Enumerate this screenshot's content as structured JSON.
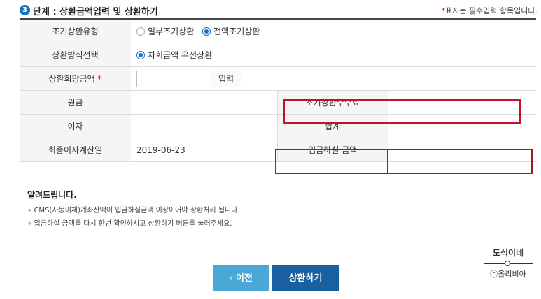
{
  "header": {
    "step_number": "3",
    "title": "단계 : 상환금액입력 및 상환하기",
    "required_star": "*",
    "required_note": "표시는 필수입력 항목입니다."
  },
  "form": {
    "type_label": "조기상환유형",
    "type_options": [
      {
        "label": "일부조기상환",
        "selected": false
      },
      {
        "label": "전액조기상환",
        "selected": true
      }
    ],
    "method_label": "상환방식선택",
    "method_option": {
      "label": "차회금액 우선상환",
      "selected": true
    },
    "amount_label": "상환희망금액",
    "amount_star": "*",
    "amount_value": "",
    "amount_button": "입력",
    "principal_label": "원금",
    "principal_value": "",
    "fee_label": "조기상환수수료",
    "fee_value": "",
    "interest_label": "이자",
    "interest_value": "",
    "total_label": "합계",
    "total_value": "",
    "last_interest_label": "최종이자계산일",
    "last_interest_date": "2019-06-23",
    "deposit_label": "입금하실 금액",
    "deposit_value": ""
  },
  "notice": {
    "title": "알려드립니다.",
    "lines": [
      "CMS(자동이체)계좌잔액이 입금하실금액 이상이어야 상환처리 됩니다.",
      "입금하실 금액을 다시 한번 확인하시고 상환하기 버튼을 눌러주세요."
    ]
  },
  "buttons": {
    "prev": "‹ 이전",
    "submit": "상환하기"
  },
  "watermark": {
    "line1": "도식이네",
    "line2": "ⓒ올리비아"
  },
  "colors": {
    "accent": "#1a6fc4",
    "required": "#e60012",
    "highlight": "#c8102e",
    "prev_button": "#4aa8d6",
    "submit_button": "#1a5fa0"
  }
}
